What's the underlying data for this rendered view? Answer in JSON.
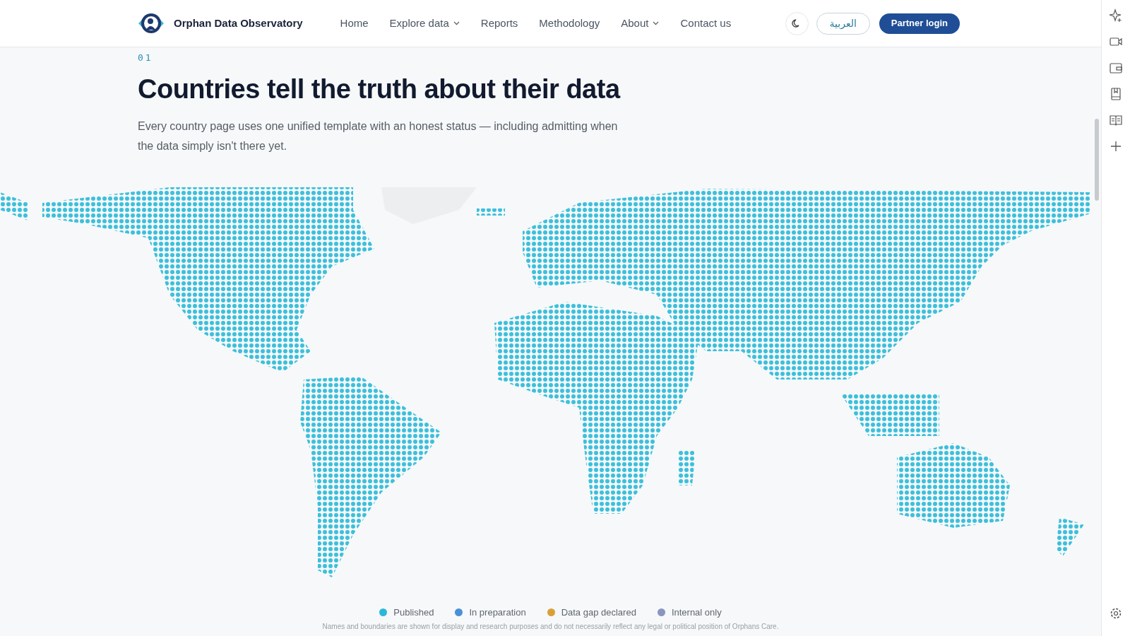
{
  "header": {
    "brand": "Orphan Data Observatory",
    "nav": [
      {
        "label": "Home",
        "dropdown": false
      },
      {
        "label": "Explore data",
        "dropdown": true
      },
      {
        "label": "Reports",
        "dropdown": false
      },
      {
        "label": "Methodology",
        "dropdown": false
      },
      {
        "label": "About",
        "dropdown": true
      },
      {
        "label": "Contact us",
        "dropdown": false
      }
    ],
    "language_button": "العربية",
    "login_button": "Partner login"
  },
  "section": {
    "number": "01",
    "title": "Countries tell the truth about their data",
    "description": "Every country page uses one unified template with an honest status — including admitting when the data simply isn't there yet."
  },
  "legend": [
    {
      "label": "Published",
      "color": "#2bb8d9"
    },
    {
      "label": "In preparation",
      "color": "#4a90d9"
    },
    {
      "label": "Data gap declared",
      "color": "#d9a03a"
    },
    {
      "label": "Internal only",
      "color": "#8a96c0"
    }
  ],
  "disclaimer": "Names and boundaries are shown for display and research purposes and do not necessarily reflect any legal or political position of Orphans Care."
}
